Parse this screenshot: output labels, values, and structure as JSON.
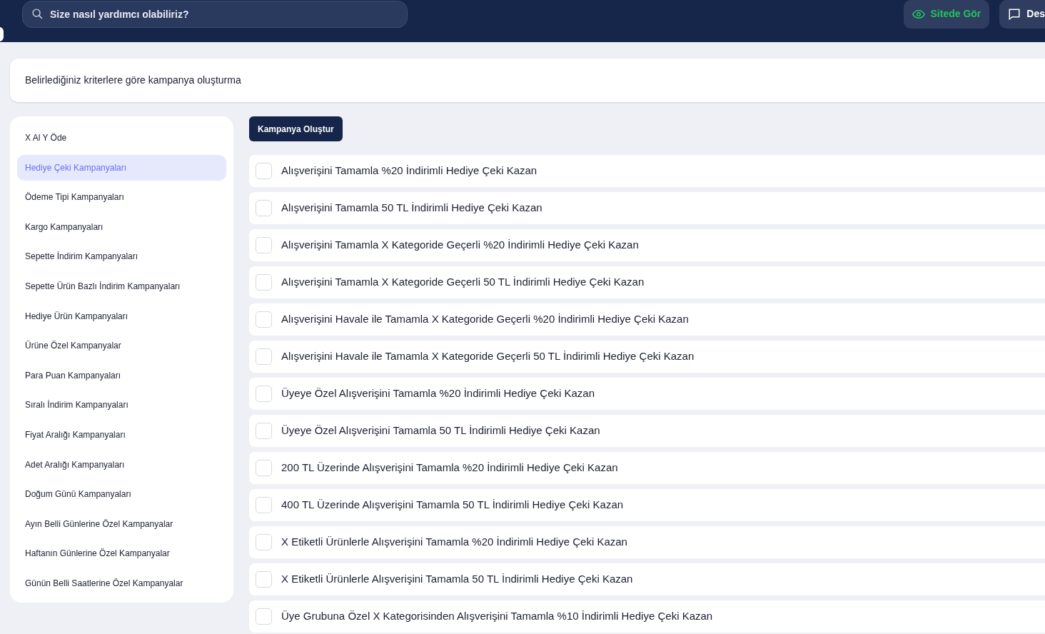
{
  "header": {
    "search": {
      "placeholder": "Size nasıl yardımcı olabiliriz?"
    },
    "buttons": [
      {
        "kind": "view",
        "label": "Sitede Gör"
      },
      {
        "kind": "chat",
        "label": "Des"
      }
    ]
  },
  "page_title": "Belirlediğiniz kriterlere göre kampanya oluşturma",
  "sidebar": {
    "items": [
      {
        "label": "X Al Y Öde",
        "selected": false
      },
      {
        "label": "Hediye Çeki Kampanyaları",
        "selected": true
      },
      {
        "label": "Ödeme Tipi Kampanyaları",
        "selected": false
      },
      {
        "label": "Kargo Kampanyaları",
        "selected": false
      },
      {
        "label": "Sepette İndirim Kampanyaları",
        "selected": false
      },
      {
        "label": "Sepette Ürün Bazlı İndirim Kampanyaları",
        "selected": false
      },
      {
        "label": "Hediye Ürün Kampanyaları",
        "selected": false
      },
      {
        "label": "Ürüne Özel Kampanyalar",
        "selected": false
      },
      {
        "label": "Para Puan Kampanyaları",
        "selected": false
      },
      {
        "label": "Sıralı İndirim Kampanyaları",
        "selected": false
      },
      {
        "label": "Fiyat Aralığı Kampanyaları",
        "selected": false
      },
      {
        "label": "Adet Aralığı Kampanyaları",
        "selected": false
      },
      {
        "label": "Doğum Günü Kampanyaları",
        "selected": false
      },
      {
        "label": "Ayın Belli Günlerine Özel Kampanyalar",
        "selected": false
      },
      {
        "label": "Haftanın Günlerine Özel Kampanyalar",
        "selected": false
      },
      {
        "label": "Günün Belli Saatlerine Özel Kampanyalar",
        "selected": false
      }
    ]
  },
  "create_button": "Kampanya Oluştur",
  "campaigns": [
    {
      "label": "Alışverişini Tamamla %20 İndirimli Hediye Çeki Kazan",
      "checked": false
    },
    {
      "label": "Alışverişini Tamamla 50 TL İndirimli Hediye Çeki Kazan",
      "checked": false
    },
    {
      "label": "Alışverişini Tamamla X Kategoride Geçerli %20 İndirimli Hediye Çeki Kazan",
      "checked": false
    },
    {
      "label": "Alışverişini Tamamla X Kategoride Geçerli 50 TL İndirimli Hediye Çeki Kazan",
      "checked": false
    },
    {
      "label": "Alışverişini Havale ile Tamamla X Kategoride Geçerli %20 İndirimli Hediye Çeki Kazan",
      "checked": false
    },
    {
      "label": "Alışverişini Havale ile Tamamla X Kategoride Geçerli 50 TL İndirimli Hediye Çeki Kazan",
      "checked": false
    },
    {
      "label": "Üyeye Özel Alışverişini Tamamla %20 İndirimli Hediye Çeki Kazan",
      "checked": false
    },
    {
      "label": "Üyeye Özel Alışverişini Tamamla 50 TL İndirimli Hediye Çeki Kazan",
      "checked": false
    },
    {
      "label": "200 TL Üzerinde Alışverişini Tamamla %20 İndirimli Hediye Çeki Kazan",
      "checked": false
    },
    {
      "label": "400 TL Üzerinde Alışverişini Tamamla 50 TL İndirimli Hediye Çeki Kazan",
      "checked": false
    },
    {
      "label": "X Etiketli Ürünlerle Alışverişini Tamamla %20 İndirimli Hediye Çeki Kazan",
      "checked": false
    },
    {
      "label": "X Etiketli Ürünlerle Alışverişini Tamamla 50 TL İndirimli Hediye Çeki Kazan",
      "checked": false
    },
    {
      "label": "Üye Grubuna Özel X Kategorisinden Alışverişini Tamamla %10 İndirimli Hediye Çeki Kazan",
      "checked": false
    }
  ]
}
